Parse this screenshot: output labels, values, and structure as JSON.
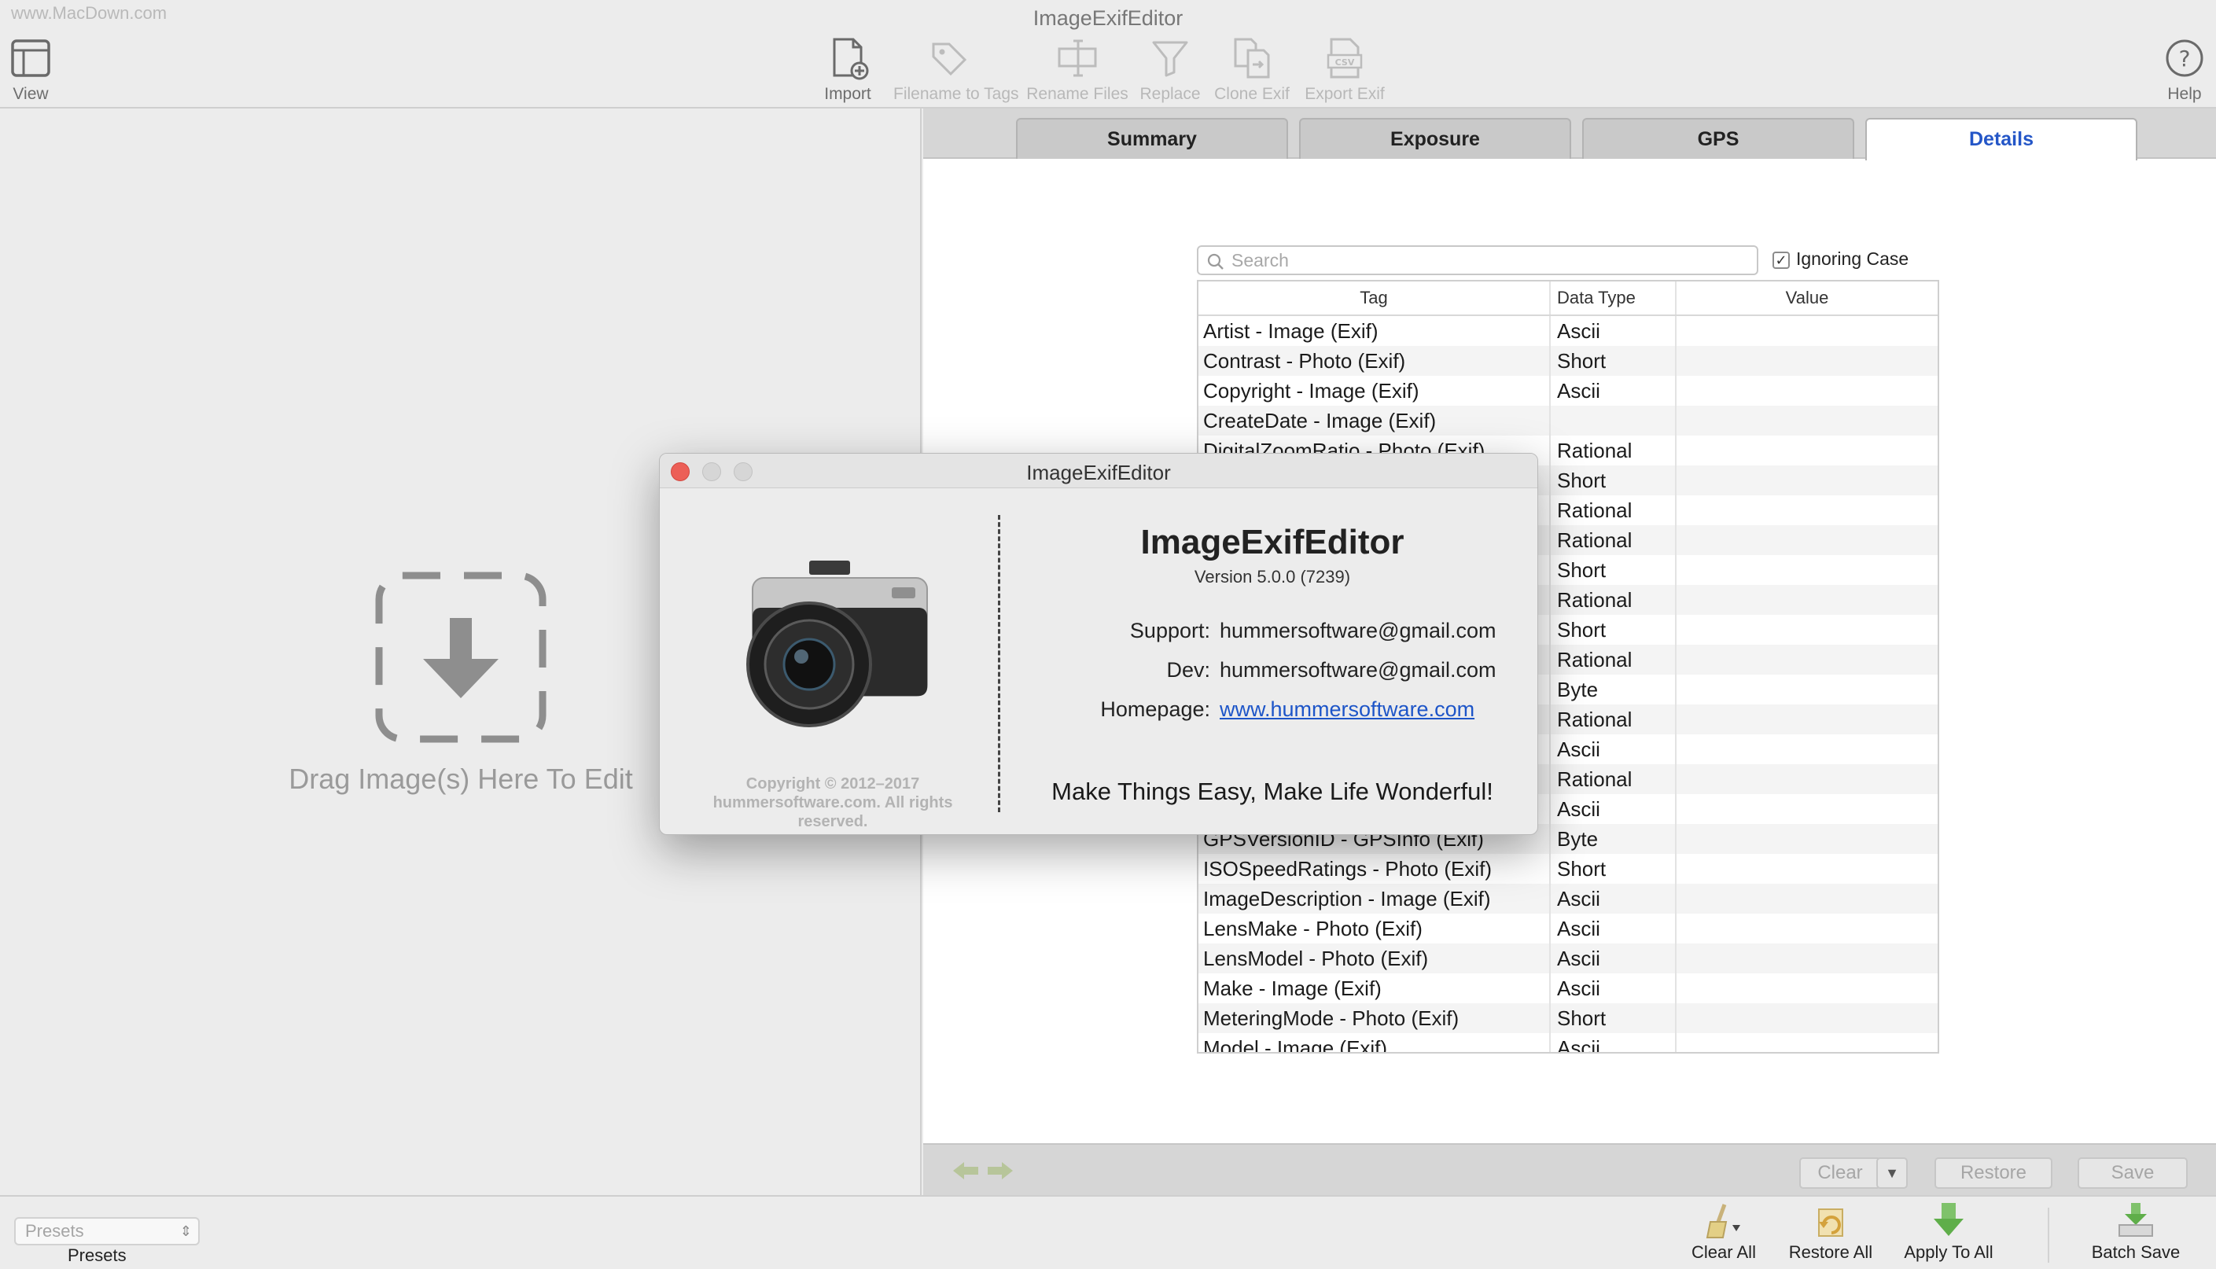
{
  "window": {
    "title": "ImageExifEditor",
    "watermark": "www.MacDown.com"
  },
  "toolbar": {
    "view": "View",
    "import": "Import",
    "filename_to_tags": "Filename to Tags",
    "rename_files": "Rename Files",
    "replace": "Replace",
    "clone_exif": "Clone Exif",
    "export_exif": "Export Exif",
    "help": "Help"
  },
  "left_pane": {
    "drop_label": "Drag Image(s) Here To Edit"
  },
  "tabs": [
    {
      "label": "Summary"
    },
    {
      "label": "Exposure"
    },
    {
      "label": "GPS"
    },
    {
      "label": "Details",
      "active": true
    }
  ],
  "details": {
    "search_placeholder": "Search",
    "ignoring_case_label": "Ignoring Case",
    "ignoring_case_checked": true,
    "columns": {
      "tag": "Tag",
      "data_type": "Data Type",
      "value": "Value"
    },
    "rows": [
      {
        "tag": "Artist - Image (Exif)",
        "type": "Ascii",
        "value": ""
      },
      {
        "tag": "Contrast - Photo (Exif)",
        "type": "Short",
        "value": ""
      },
      {
        "tag": "Copyright - Image (Exif)",
        "type": "Ascii",
        "value": ""
      },
      {
        "tag": "CreateDate - Image (Exif)",
        "type": "",
        "value": ""
      },
      {
        "tag": "DigitalZoomRatio - Photo (Exif)",
        "type": "Rational",
        "value": ""
      },
      {
        "tag": "",
        "type": "Short",
        "value": ""
      },
      {
        "tag": "",
        "type": "Rational",
        "value": ""
      },
      {
        "tag": "",
        "type": "Rational",
        "value": ""
      },
      {
        "tag": "",
        "type": "Short",
        "value": ""
      },
      {
        "tag": "",
        "type": "Rational",
        "value": ""
      },
      {
        "tag": "",
        "type": "Short",
        "value": ""
      },
      {
        "tag": "",
        "type": "Rational",
        "value": ""
      },
      {
        "tag": "",
        "type": "Byte",
        "value": ""
      },
      {
        "tag": "",
        "type": "Rational",
        "value": ""
      },
      {
        "tag": "",
        "type": "Ascii",
        "value": ""
      },
      {
        "tag": "",
        "type": "Rational",
        "value": ""
      },
      {
        "tag": "",
        "type": "Ascii",
        "value": ""
      },
      {
        "tag": "GPSVersionID - GPSInfo (Exif)",
        "type": "Byte",
        "value": ""
      },
      {
        "tag": "ISOSpeedRatings - Photo (Exif)",
        "type": "Short",
        "value": ""
      },
      {
        "tag": "ImageDescription - Image (Exif)",
        "type": "Ascii",
        "value": ""
      },
      {
        "tag": "LensMake - Photo (Exif)",
        "type": "Ascii",
        "value": ""
      },
      {
        "tag": "LensModel - Photo (Exif)",
        "type": "Ascii",
        "value": ""
      },
      {
        "tag": "Make - Image (Exif)",
        "type": "Ascii",
        "value": ""
      },
      {
        "tag": "MeteringMode - Photo (Exif)",
        "type": "Short",
        "value": ""
      },
      {
        "tag": "Model - Image (Exif)",
        "type": "Ascii",
        "value": ""
      }
    ]
  },
  "right_bottom": {
    "clear": "Clear",
    "restore": "Restore",
    "save": "Save"
  },
  "bottom_bar": {
    "presets_value": "Presets",
    "presets_label": "Presets",
    "clear_all": "Clear All",
    "restore_all": "Restore All",
    "apply_to_all": "Apply To All",
    "batch_save": "Batch Save"
  },
  "about": {
    "title": "ImageExifEditor",
    "app_name": "ImageExifEditor",
    "version": "Version 5.0.0 (7239)",
    "support_label": "Support:",
    "support_value": "hummersoftware@gmail.com",
    "dev_label": "Dev:",
    "dev_value": "hummersoftware@gmail.com",
    "homepage_label": "Homepage:",
    "homepage_value": "www.hummersoftware.com",
    "copyright": "Copyright © 2012–2017 hummersoftware.com. All rights reserved.",
    "slogan": "Make Things Easy, Make Life Wonderful!"
  },
  "colors": {
    "accent": "#2456c7",
    "link": "#1d55c8",
    "close": "#ec5f57"
  }
}
